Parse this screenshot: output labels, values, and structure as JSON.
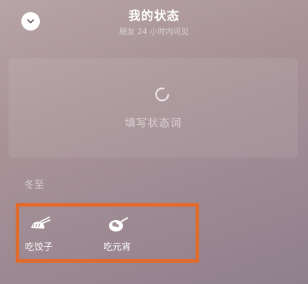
{
  "header": {
    "title": "我的状态",
    "subtitle": "朋友 24 小时内可见",
    "back_icon": "chevron-down-icon"
  },
  "status_card": {
    "placeholder": "填写状态词",
    "icon": "loading-ring-icon"
  },
  "section": {
    "label": "冬至",
    "items": [
      {
        "label": "吃饺子",
        "icon": "dumpling-chopsticks-icon"
      },
      {
        "label": "吃元宵",
        "icon": "tangyuan-bowl-icon"
      }
    ]
  },
  "colors": {
    "highlight_border": "#e06b2c",
    "background": "#a89497"
  }
}
